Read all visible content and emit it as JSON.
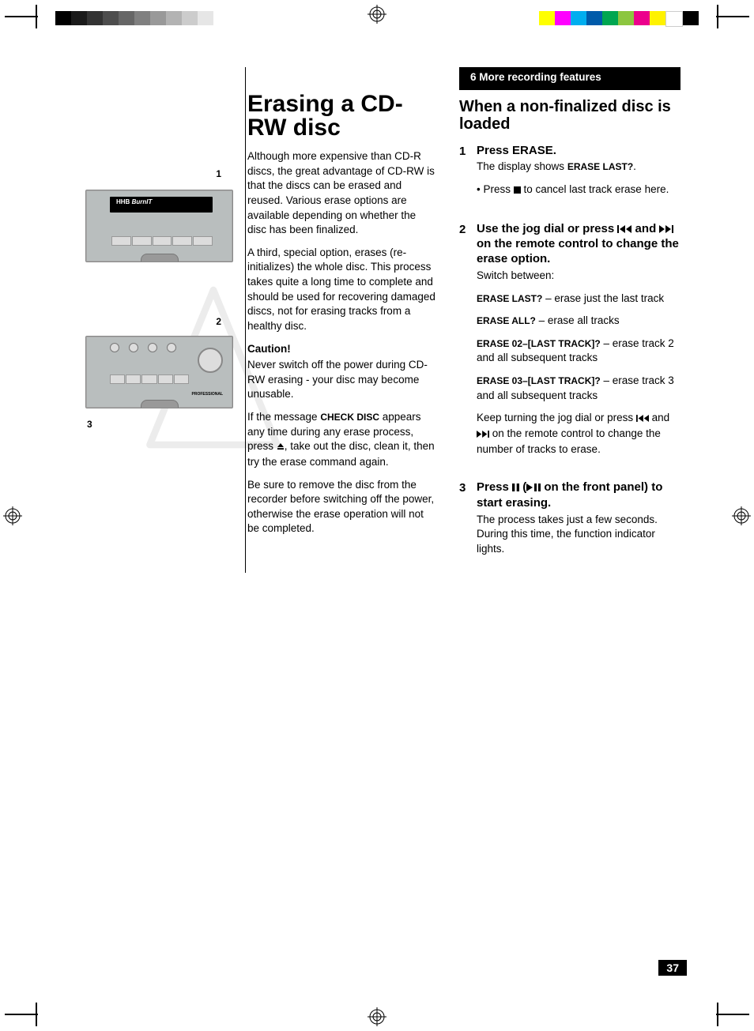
{
  "print_marks": {
    "gray_bar": [
      "#000000",
      "#1a1a1a",
      "#333333",
      "#4d4d4d",
      "#666666",
      "#808080",
      "#999999",
      "#b3b3b3",
      "#cccccc",
      "#e6e6e6"
    ],
    "color_bar": [
      "#ffff00",
      "#ff00ff",
      "#00aeef",
      "#005baa",
      "#00a651",
      "#8cc63f",
      "#ec008c",
      "#fff200",
      "#ffffff",
      "#000000"
    ]
  },
  "sidebar": {
    "label1": "1",
    "label2": "2",
    "label3": "3",
    "device1_brand": "HHB",
    "device1_sub": "BurnIT",
    "device2_label": "PROFESSIONAL"
  },
  "col1": {
    "title": "Erasing a CD-RW disc",
    "para1": "Although more expensive than CD-R discs, the great advantage of CD-RW is that the discs can be erased and reused. Various erase options are available depending on whether the disc has been finalized.",
    "para2": "A third, special option, erases (re-initializes) the whole disc. This process takes quite a long time to complete and should be used for recovering damaged discs, not for erasing tracks from a healthy disc.",
    "caution_head": "Caution!",
    "caution1": "Never switch off the power during CD-RW erasing - your disc may become unusable.",
    "caution2a": "If the message ",
    "caution2_sc": "CHECK DISC",
    "caution2b": " appears any time during any erase process, press ",
    "caution2c": ", take out the disc, clean it, then try the erase command again.",
    "caution3": "Be sure to remove the disc from the recorder before switching off the power, otherwise the erase operation will not be completed."
  },
  "col2": {
    "section_bar": "6 More recording features",
    "subhead": "When a non-finalized disc is loaded",
    "step1_title": "Press ERASE.",
    "step1_sub_a": "The display shows ",
    "step1_sc": "ERASE LAST?",
    "step1_sub_b": ".",
    "step1_bullet_a": "Press ",
    "step1_bullet_b": " to cancel last track erase here.",
    "step2_title_a": "Use the jog dial or press ",
    "step2_title_b": " and ",
    "step2_title_c": " on the remote control to change the erase option.",
    "step2_sub": "Switch between:",
    "step2_opt1_sc": "ERASE LAST?",
    "step2_opt1_txt": " – erase just the last track",
    "step2_opt2_sc": "ERASE ALL?",
    "step2_opt2_txt": " – erase all tracks",
    "step2_opt3_sc": "ERASE 02–[LAST TRACK]?",
    "step2_opt3_txt": " – erase track 2 and all subsequent tracks",
    "step2_opt4_sc": "ERASE 03–[LAST TRACK]?",
    "step2_opt4_txt": " – erase track 3 and all subsequent tracks",
    "step2_tail_a": "Keep turning the jog dial or press ",
    "step2_tail_b": " and ",
    "step2_tail_c": " on the remote control to change the number of tracks to erase.",
    "step3_title_a": "Press ",
    "step3_title_b": " (",
    "step3_title_c": " on the front panel) to start erasing.",
    "step3_sub": "The process takes just a few seconds. During this time, the function indicator lights."
  },
  "page_number": "37"
}
